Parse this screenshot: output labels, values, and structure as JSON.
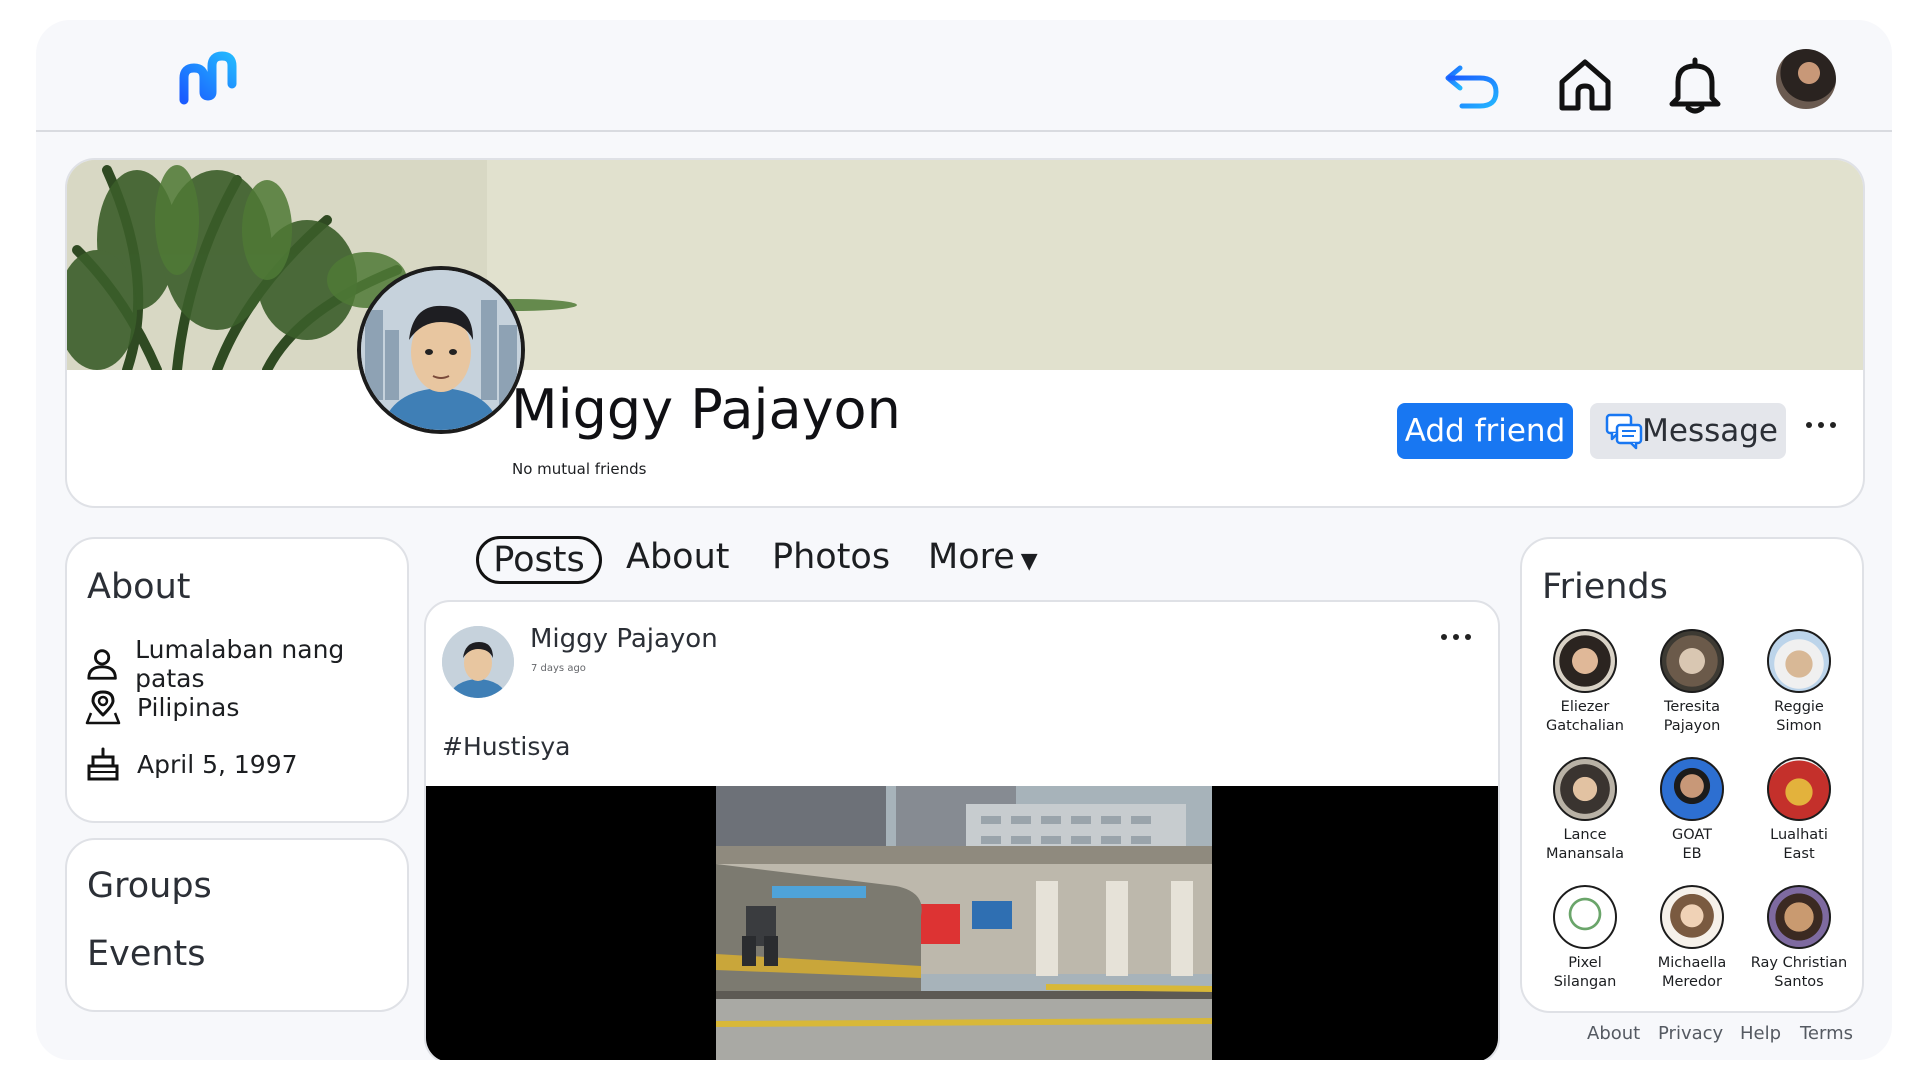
{
  "topbar": {
    "logo": "app-logo",
    "icons": [
      "back-arrow-icon",
      "home-icon",
      "bell-icon"
    ],
    "accent_color": "#1877f2"
  },
  "profile": {
    "name": "Miggy Pajayon",
    "mutual_friends": "No mutual friends",
    "add_friend_label": "Add friend",
    "message_label": "Message"
  },
  "about": {
    "title": "About",
    "items": [
      {
        "icon": "person-icon",
        "text": "Lumalaban nang patas"
      },
      {
        "icon": "location-pin-icon",
        "text": "Pilipinas"
      },
      {
        "icon": "birthday-cake-icon",
        "text": "April 5, 1997"
      }
    ]
  },
  "links": {
    "items": [
      "Groups",
      "Events"
    ]
  },
  "tabs": [
    {
      "label": "Posts",
      "active": true
    },
    {
      "label": "About"
    },
    {
      "label": "Photos"
    },
    {
      "label": "More"
    }
  ],
  "post": {
    "author": "Miggy Pajayon",
    "time": "7 days ago",
    "text": "#Hustisya"
  },
  "friends": {
    "title": "Friends",
    "items": [
      {
        "name": "Eliezer\nGatchalian"
      },
      {
        "name": "Teresita\nPajayon"
      },
      {
        "name": "Reggie\nSimon"
      },
      {
        "name": "Lance\nManansala"
      },
      {
        "name": "GOAT\nEB"
      },
      {
        "name": "Lualhati\nEast"
      },
      {
        "name": "Pixel\nSilangan"
      },
      {
        "name": "Michaella\nMeredor"
      },
      {
        "name": "Ray Christian\nSantos"
      }
    ]
  },
  "footer": [
    "About",
    "Privacy",
    "Help",
    "Terms"
  ]
}
